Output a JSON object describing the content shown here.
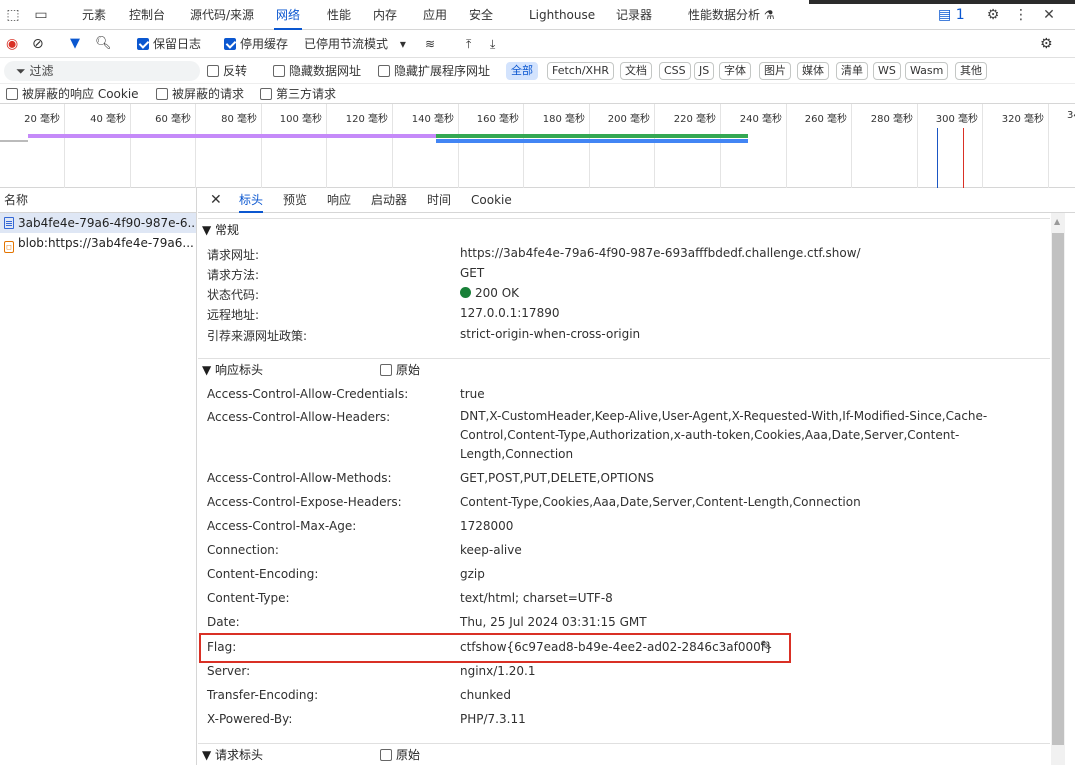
{
  "topbar": {
    "tabs": [
      "元素",
      "控制台",
      "源代码/来源",
      "网络",
      "性能",
      "内存",
      "应用",
      "安全",
      "Lighthouse",
      "记录器",
      "性能数据分析 ⚗"
    ],
    "active_tab": "网络",
    "issues_count": "1"
  },
  "toolbar": {
    "preserve_log": "保留日志",
    "disable_cache": "停用缓存",
    "throttling": "已停用节流模式"
  },
  "filterbar": {
    "filter_placeholder": "过滤",
    "invert": "反转",
    "hide_data_urls": "隐藏数据网址",
    "hide_extension_urls": "隐藏扩展程序网址",
    "types": [
      "全部",
      "Fetch/XHR",
      "文档",
      "CSS",
      "JS",
      "字体",
      "图片",
      "媒体",
      "清单",
      "WS",
      "Wasm",
      "其他"
    ]
  },
  "blockedbar": {
    "blocked_cookies": "被屏蔽的响应 Cookie",
    "blocked_requests": "被屏蔽的请求",
    "third_party": "第三方请求"
  },
  "timeline": {
    "ticks": [
      "20 毫秒",
      "40 毫秒",
      "60 毫秒",
      "80 毫秒",
      "100 毫秒",
      "120 毫秒",
      "140 毫秒",
      "160 毫秒",
      "180 毫秒",
      "200 毫秒",
      "220 毫秒",
      "240 毫秒",
      "260 毫秒",
      "280 毫秒",
      "300 毫秒",
      "320 毫秒",
      "34"
    ]
  },
  "requests": {
    "header": "名称",
    "items": [
      "3ab4fe4e-79a6-4f90-987e-6...",
      "blob:https://3ab4fe4e-79a6..."
    ]
  },
  "details": {
    "tabs": [
      "标头",
      "预览",
      "响应",
      "启动器",
      "时间",
      "Cookie"
    ],
    "active_tab": "标头",
    "general": {
      "title": "▼ 常规",
      "rows": [
        {
          "k": "请求网址:",
          "v": "https://3ab4fe4e-79a6-4f90-987e-693afffbdedf.challenge.ctf.show/"
        },
        {
          "k": "请求方法:",
          "v": "GET"
        },
        {
          "k": "状态代码:",
          "v": "200 OK"
        },
        {
          "k": "远程地址:",
          "v": "127.0.0.1:17890"
        },
        {
          "k": "引荐来源网址政策:",
          "v": "strict-origin-when-cross-origin"
        }
      ]
    },
    "response_headers": {
      "title": "▼ 响应标头",
      "raw": "原始",
      "rows": [
        {
          "k": "Access-Control-Allow-Credentials:",
          "v": "true"
        },
        {
          "k": "Access-Control-Allow-Headers:",
          "v": "DNT,X-CustomHeader,Keep-Alive,User-Agent,X-Requested-With,If-Modified-Since,Cache-Control,Content-Type,Authorization,x-auth-token,Cookies,Aaa,Date,Server,Content-Length,Connection"
        },
        {
          "k": "Access-Control-Allow-Methods:",
          "v": "GET,POST,PUT,DELETE,OPTIONS"
        },
        {
          "k": "Access-Control-Expose-Headers:",
          "v": "Content-Type,Cookies,Aaa,Date,Server,Content-Length,Connection"
        },
        {
          "k": "Access-Control-Max-Age:",
          "v": "1728000"
        },
        {
          "k": "Connection:",
          "v": "keep-alive"
        },
        {
          "k": "Content-Encoding:",
          "v": "gzip"
        },
        {
          "k": "Content-Type:",
          "v": "text/html; charset=UTF-8"
        },
        {
          "k": "Date:",
          "v": "Thu, 25 Jul 2024 03:31:15 GMT"
        },
        {
          "k": "Flag:",
          "v": "ctfshow{6c97ead8-b49e-4ee2-ad02-2846c3af000f}"
        },
        {
          "k": "Server:",
          "v": "nginx/1.20.1"
        },
        {
          "k": "Transfer-Encoding:",
          "v": "chunked"
        },
        {
          "k": "X-Powered-By:",
          "v": "PHP/7.3.11"
        }
      ]
    },
    "request_headers": {
      "title": "▼ 请求标头",
      "raw": "原始"
    }
  },
  "colors": {
    "accent": "#0b57d0",
    "flag_highlight": "#d93025",
    "status_ok": "#188038"
  }
}
